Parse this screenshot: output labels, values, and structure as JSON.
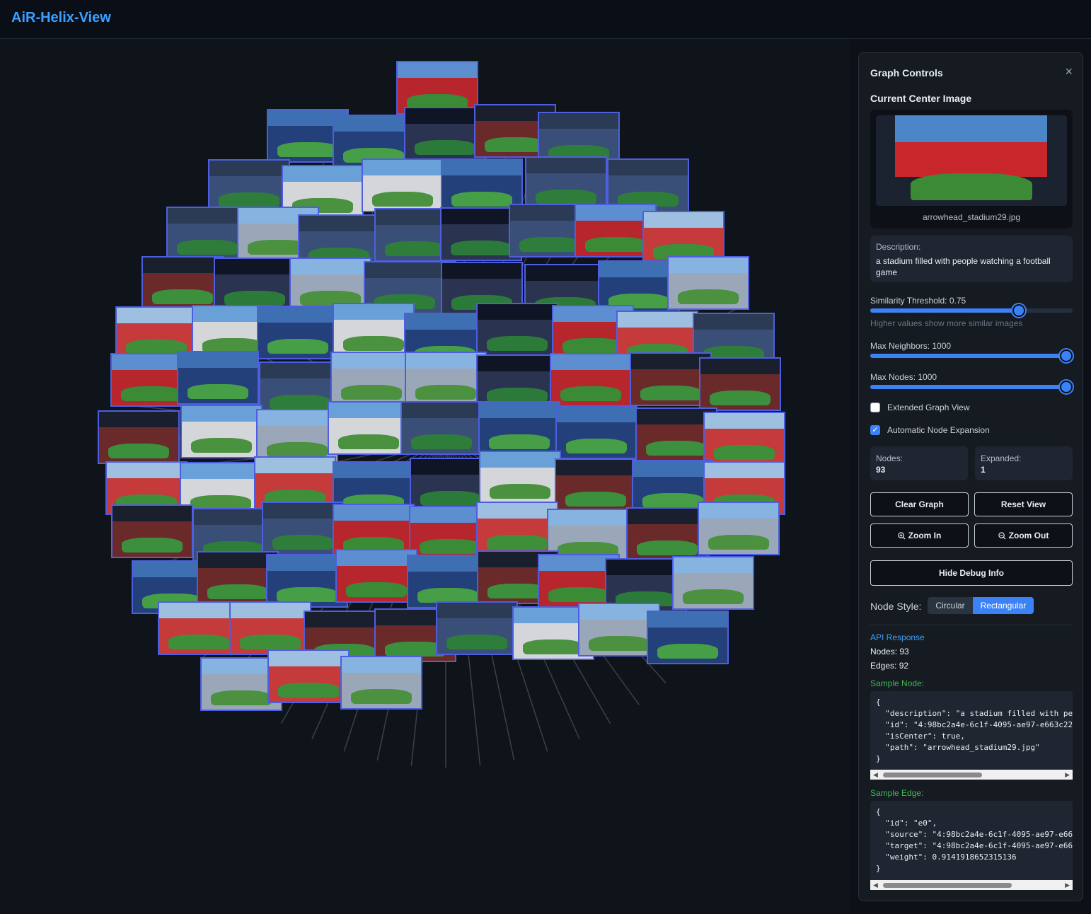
{
  "app": {
    "title": "AiR-Helix-View"
  },
  "graph": {
    "node_style": "rectangular",
    "node_border_color": "#4d5fe0"
  },
  "panel": {
    "title": "Graph Controls",
    "close_icon": "×",
    "center_section_title": "Current Center Image",
    "center_image_name": "arrowhead_stadium29.jpg",
    "description_label": "Description:",
    "description_text": "a stadium filled with people watching a football game",
    "similarity_label": "Similarity Threshold: 0.75",
    "similarity_value": 0.75,
    "similarity_hint": "Higher values show more similar images",
    "max_neighbors_label": "Max Neighbors: 1000",
    "max_neighbors_fraction": 1.0,
    "max_nodes_label": "Max Nodes: 1000",
    "max_nodes_fraction": 1.0,
    "extended_view_label": "Extended Graph View",
    "extended_view_checked": false,
    "auto_expand_label": "Automatic Node Expansion",
    "auto_expand_checked": true,
    "nodes_label": "Nodes:",
    "nodes_value": "93",
    "expanded_label": "Expanded:",
    "expanded_value": "1",
    "clear_graph": "Clear Graph",
    "reset_view": "Reset View",
    "zoom_in": "Zoom In",
    "zoom_out": "Zoom Out",
    "hide_debug": "Hide Debug Info",
    "node_style_label": "Node Style:",
    "style_circular": "Circular",
    "style_rectangular": "Rectangular",
    "api_title": "API Response",
    "api_nodes": "Nodes: 93",
    "api_edges": "Edges: 92",
    "sample_node_title": "Sample Node:",
    "sample_node_code": "{\n  \"description\": \"a stadium filled with pe\n  \"id\": \"4:98bc2a4e-6c1f-4095-ae97-e663c22\n  \"isCenter\": true,\n  \"path\": \"arrowhead_stadium29.jpg\"\n}",
    "sample_edge_title": "Sample Edge:",
    "sample_edge_code": "{\n  \"id\": \"e0\",\n  \"source\": \"4:98bc2a4e-6c1f-4095-ae97-e66\n  \"target\": \"4:98bc2a4e-6c1f-4095-ae97-e66\n  \"weight\": 0.9141918652315136\n}"
  }
}
